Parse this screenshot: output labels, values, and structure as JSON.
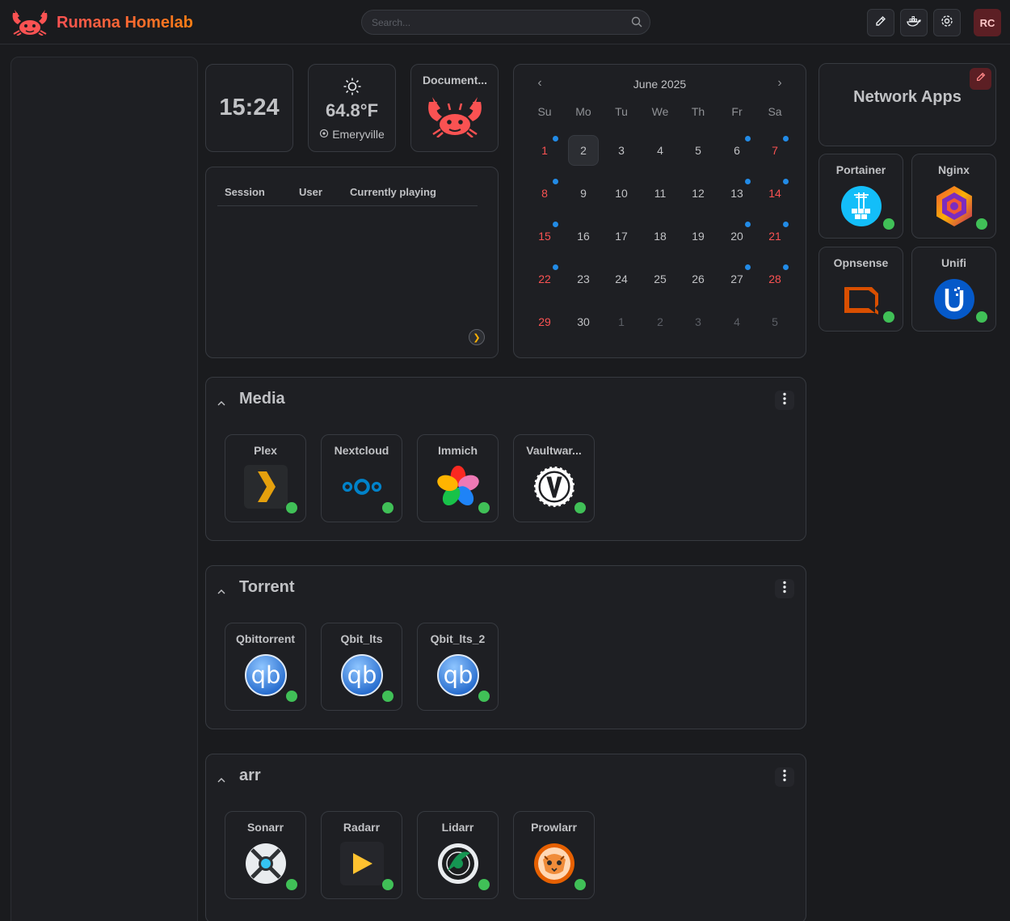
{
  "header": {
    "brand_title": "Rumana Homelab",
    "search_placeholder": "Search...",
    "avatar_initials": "RC",
    "buttons": [
      "edit-icon",
      "docker-icon",
      "gear-icon"
    ]
  },
  "clock": {
    "time": "15:24"
  },
  "weather": {
    "temperature": "64.8°F",
    "location": "Emeryville",
    "icon": "sun-icon"
  },
  "docs_app": {
    "name": "Document..."
  },
  "sessions": {
    "columns": [
      "Session",
      "User",
      "Currently playing"
    ],
    "rows": []
  },
  "calendar": {
    "month": "June 2025",
    "weekdays": [
      "Su",
      "Mo",
      "Tu",
      "We",
      "Th",
      "Fr",
      "Sa"
    ],
    "weeks": [
      [
        "1",
        "2",
        "3",
        "4",
        "5",
        "6",
        "7"
      ],
      [
        "8",
        "9",
        "10",
        "11",
        "12",
        "13",
        "14"
      ],
      [
        "15",
        "16",
        "17",
        "18",
        "19",
        "20",
        "21"
      ],
      [
        "22",
        "23",
        "24",
        "25",
        "26",
        "27",
        "28"
      ],
      [
        "29",
        "30",
        "1",
        "2",
        "3",
        "4",
        "5"
      ]
    ],
    "today": "2",
    "event_days": [
      "1",
      "6",
      "7",
      "8",
      "13",
      "14",
      "15",
      "20",
      "21",
      "22",
      "27",
      "28"
    ]
  },
  "network_apps": {
    "title": "Network Apps",
    "apps": [
      {
        "name": "Portainer",
        "icon": "portainer-icon"
      },
      {
        "name": "Nginx",
        "icon": "nginx-icon"
      },
      {
        "name": "Opnsense",
        "icon": "opnsense-icon"
      },
      {
        "name": "Unifi",
        "icon": "unifi-icon"
      }
    ]
  },
  "sections": [
    {
      "title": "Media",
      "apps": [
        {
          "name": "Plex",
          "icon": "plex-icon"
        },
        {
          "name": "Nextcloud",
          "icon": "nextcloud-icon"
        },
        {
          "name": "Immich",
          "icon": "immich-icon"
        },
        {
          "name": "Vaultwar...",
          "icon": "vaultwarden-icon"
        }
      ]
    },
    {
      "title": "Torrent",
      "apps": [
        {
          "name": "Qbittorrent",
          "icon": "qbittorrent-icon"
        },
        {
          "name": "Qbit_lts",
          "icon": "qbittorrent-icon"
        },
        {
          "name": "Qbit_lts_2",
          "icon": "qbittorrent-icon"
        }
      ]
    },
    {
      "title": "arr",
      "apps": [
        {
          "name": "Sonarr",
          "icon": "sonarr-icon"
        },
        {
          "name": "Radarr",
          "icon": "radarr-icon"
        },
        {
          "name": "Lidarr",
          "icon": "lidarr-icon"
        },
        {
          "name": "Prowlarr",
          "icon": "prowlarr-icon"
        }
      ]
    }
  ],
  "colors": {
    "accent": "#fa5252",
    "status_online": "#40c057",
    "event_dot": "#228be6",
    "background": "#1a1b1e"
  }
}
